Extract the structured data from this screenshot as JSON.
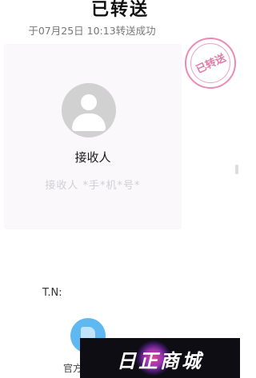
{
  "header": {
    "title": "已转送",
    "subtitle": "于07月25日 10:13转送成功"
  },
  "stamp": {
    "text": "已转送",
    "color": "#e27aa8"
  },
  "recipient": {
    "label": "接收人",
    "phone": "接收人 *手*机*号*"
  },
  "footer": {
    "tn_label": "T.N:",
    "official_label": "官方"
  },
  "banner": {
    "logo_text": "日正商城"
  },
  "icons": {
    "avatar": "user-avatar-icon",
    "app": "official-app-icon"
  }
}
